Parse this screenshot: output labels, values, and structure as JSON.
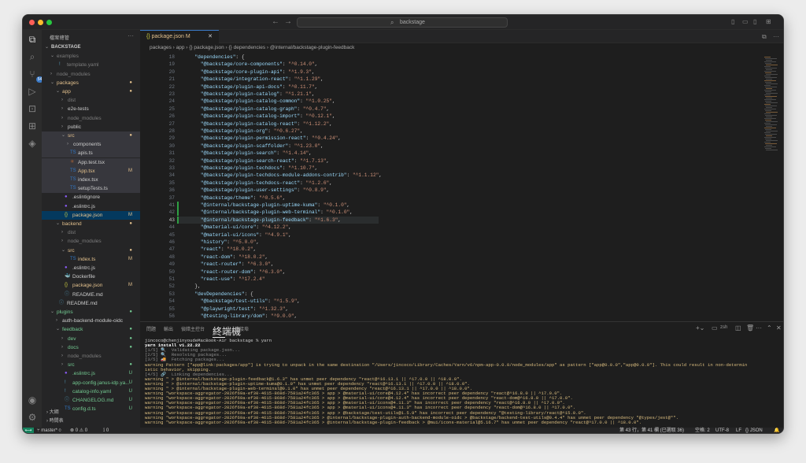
{
  "window": {
    "search_text": "backstage",
    "traffic": {
      "close": "#ff5f57",
      "min": "#febc2e",
      "max": "#28c840"
    }
  },
  "sidebar": {
    "header": "檔案總管",
    "more": "···",
    "tree": [
      {
        "label": "BACKSTAGE",
        "indent": 0,
        "arrow": "⌄",
        "style": "root"
      },
      {
        "label": "examples",
        "indent": 1,
        "arrow": "⌄",
        "style": "dim"
      },
      {
        "label": "template.yaml",
        "indent": 2,
        "arrow": "",
        "style": "dim",
        "icon": "!"
      },
      {
        "label": "node_modules",
        "indent": 1,
        "arrow": "›",
        "style": "dim"
      },
      {
        "label": "packages",
        "indent": 1,
        "arrow": "⌄",
        "style": "mod",
        "status": "●"
      },
      {
        "label": "app",
        "indent": 2,
        "arrow": "⌄",
        "style": "mod",
        "status": "●"
      },
      {
        "label": "dist",
        "indent": 3,
        "arrow": "›",
        "style": "dim"
      },
      {
        "label": "e2e-tests",
        "indent": 3,
        "arrow": "›",
        "style": ""
      },
      {
        "label": "node_modules",
        "indent": 3,
        "arrow": "›",
        "style": "dim"
      },
      {
        "label": "public",
        "indent": 3,
        "arrow": "›",
        "style": ""
      },
      {
        "label": "src",
        "indent": 3,
        "arrow": "⌄",
        "style": "mod",
        "status": "●",
        "sel": true
      },
      {
        "label": "components",
        "indent": 4,
        "arrow": "›",
        "style": "",
        "sel": true
      },
      {
        "label": "apis.ts",
        "indent": 4,
        "arrow": "",
        "style": "",
        "icon": "TS",
        "sel": true
      },
      {
        "label": "App.test.tsx",
        "indent": 4,
        "arrow": "",
        "style": "",
        "icon": "⚛",
        "sel": true
      },
      {
        "label": "App.tsx",
        "indent": 4,
        "arrow": "",
        "style": "mod",
        "icon": "TS",
        "status": "M",
        "sel": true
      },
      {
        "label": "index.tsx",
        "indent": 4,
        "arrow": "",
        "style": "",
        "icon": "TS",
        "sel": true
      },
      {
        "label": "setupTests.ts",
        "indent": 4,
        "arrow": "",
        "style": "",
        "icon": "TS",
        "sel": true
      },
      {
        "label": ".eslintignore",
        "indent": 3,
        "arrow": "",
        "style": "",
        "icon": "●"
      },
      {
        "label": ".eslintrc.js",
        "indent": 3,
        "arrow": "",
        "style": "",
        "icon": "●"
      },
      {
        "label": "package.json",
        "indent": 3,
        "arrow": "",
        "style": "mod",
        "icon": "{}",
        "status": "M",
        "cur": true
      },
      {
        "label": "backend",
        "indent": 2,
        "arrow": "⌄",
        "style": "mod",
        "status": "●"
      },
      {
        "label": "dist",
        "indent": 3,
        "arrow": "›",
        "style": "dim"
      },
      {
        "label": "node_modules",
        "indent": 3,
        "arrow": "›",
        "style": "dim"
      },
      {
        "label": "src",
        "indent": 3,
        "arrow": "⌄",
        "style": "mod",
        "status": "●"
      },
      {
        "label": "index.ts",
        "indent": 4,
        "arrow": "",
        "style": "mod",
        "icon": "TS",
        "status": "M"
      },
      {
        "label": ".eslintrc.js",
        "indent": 3,
        "arrow": "",
        "style": "",
        "icon": "●"
      },
      {
        "label": "Dockerfile",
        "indent": 3,
        "arrow": "",
        "style": "",
        "icon": "🐳"
      },
      {
        "label": "package.json",
        "indent": 3,
        "arrow": "",
        "style": "mod",
        "icon": "{}",
        "status": "M"
      },
      {
        "label": "README.md",
        "indent": 3,
        "arrow": "",
        "style": "",
        "icon": "ⓘ"
      },
      {
        "label": "README.md",
        "indent": 2,
        "arrow": "",
        "style": "",
        "icon": "ⓘ"
      },
      {
        "label": "plugins",
        "indent": 1,
        "arrow": "⌄",
        "style": "unt",
        "status": "●"
      },
      {
        "label": "auth-backend-module-oidc",
        "indent": 2,
        "arrow": "›",
        "style": ""
      },
      {
        "label": "feedback",
        "indent": 2,
        "arrow": "⌄",
        "style": "unt",
        "status": "●"
      },
      {
        "label": "dev",
        "indent": 3,
        "arrow": "›",
        "style": "unt",
        "status": "●"
      },
      {
        "label": "docs",
        "indent": 3,
        "arrow": "›",
        "style": "unt",
        "status": "●"
      },
      {
        "label": "node_modules",
        "indent": 3,
        "arrow": "›",
        "style": "dim"
      },
      {
        "label": "src",
        "indent": 3,
        "arrow": "›",
        "style": "unt",
        "status": "●"
      },
      {
        "label": ".eslintrc.js",
        "indent": 3,
        "arrow": "",
        "style": "unt",
        "icon": "●",
        "status": "U"
      },
      {
        "label": "app-config.janus-idp.ya...",
        "indent": 3,
        "arrow": "",
        "style": "unt",
        "icon": "!",
        "status": "U"
      },
      {
        "label": "catalog-info.yaml",
        "indent": 3,
        "arrow": "",
        "style": "unt",
        "icon": "!",
        "status": "U"
      },
      {
        "label": "CHANGELOG.md",
        "indent": 3,
        "arrow": "",
        "style": "unt",
        "icon": "ⓘ",
        "status": "U"
      },
      {
        "label": "config.d.ts",
        "indent": 3,
        "arrow": "",
        "style": "unt",
        "icon": "TS",
        "status": "U"
      }
    ],
    "outline": "大綱",
    "timeline": "時間表"
  },
  "editor": {
    "tab_label": "package.json",
    "tab_status": "M",
    "breadcrumb": [
      "packages",
      "app",
      "{} package.json",
      "{} dependencies",
      "@internal/backstage-plugin-feedback"
    ],
    "current_line": 43,
    "lines": [
      {
        "n": 18,
        "t": "  \"dependencies\": {"
      },
      {
        "n": 19,
        "t": "    \"@backstage/core-components\": \"^0.14.0\","
      },
      {
        "n": 20,
        "t": "    \"@backstage/core-plugin-api\": \"^1.9.3\","
      },
      {
        "n": 21,
        "t": "    \"@backstage/integration-react\": \"^1.1.29\","
      },
      {
        "n": 22,
        "t": "    \"@backstage/plugin-api-docs\": \"^0.11.7\","
      },
      {
        "n": 23,
        "t": "    \"@backstage/plugin-catalog\": \"^1.21.1\","
      },
      {
        "n": 24,
        "t": "    \"@backstage/plugin-catalog-common\": \"^1.0.25\","
      },
      {
        "n": 25,
        "t": "    \"@backstage/plugin-catalog-graph\": \"^0.4.7\","
      },
      {
        "n": 26,
        "t": "    \"@backstage/plugin-catalog-import\": \"^0.12.1\","
      },
      {
        "n": 27,
        "t": "    \"@backstage/plugin-catalog-react\": \"^1.12.2\","
      },
      {
        "n": 28,
        "t": "    \"@backstage/plugin-org\": \"^0.6.27\","
      },
      {
        "n": 29,
        "t": "    \"@backstage/plugin-permission-react\": \"^0.4.24\","
      },
      {
        "n": 30,
        "t": "    \"@backstage/plugin-scaffolder\": \"^1.23.0\","
      },
      {
        "n": 31,
        "t": "    \"@backstage/plugin-search\": \"^1.4.14\","
      },
      {
        "n": 32,
        "t": "    \"@backstage/plugin-search-react\": \"^1.7.13\","
      },
      {
        "n": 33,
        "t": "    \"@backstage/plugin-techdocs\": \"^1.10.7\","
      },
      {
        "n": 34,
        "t": "    \"@backstage/plugin-techdocs-module-addons-contrib\": \"^1.1.12\","
      },
      {
        "n": 35,
        "t": "    \"@backstage/plugin-techdocs-react\": \"^1.2.6\","
      },
      {
        "n": 36,
        "t": "    \"@backstage/plugin-user-settings\": \"^0.8.9\","
      },
      {
        "n": 37,
        "t": "    \"@backstage/theme\": \"^0.5.6\","
      },
      {
        "n": 41,
        "t": "    \"@internal/backstage-plugin-uptime-kuma\": \"^0.1.0\","
      },
      {
        "n": 42,
        "t": "    \"@internal/backstage-plugin-web-terminal\": \"^0.1.0\","
      },
      {
        "n": 43,
        "t": "    \"@internal/backstage-plugin-feedback\": \"^1.6.3\","
      },
      {
        "n": 44,
        "t": "    \"@material-ui/core\": \"^4.12.2\","
      },
      {
        "n": 45,
        "t": "    \"@material-ui/icons\": \"^4.9.1\","
      },
      {
        "n": 46,
        "t": "    \"history\": \"^5.0.0\","
      },
      {
        "n": 47,
        "t": "    \"react\": \"^18.0.2\","
      },
      {
        "n": 48,
        "t": "    \"react-dom\": \"^18.0.2\","
      },
      {
        "n": 49,
        "t": "    \"react-router\": \"^6.3.0\","
      },
      {
        "n": 50,
        "t": "    \"react-router-dom\": \"^6.3.0\","
      },
      {
        "n": 51,
        "t": "    \"react-use\": \"^17.2.4\""
      },
      {
        "n": 52,
        "t": "  },"
      },
      {
        "n": 53,
        "t": "  \"devDependencies\": {"
      },
      {
        "n": 54,
        "t": "    \"@backstage/test-utils\": \"^1.5.9\","
      },
      {
        "n": 55,
        "t": "    \"@playwright/test\": \"^1.32.3\","
      },
      {
        "n": 56,
        "t": "    \"@testing-library/dom\": \"^9.0.0\","
      }
    ]
  },
  "panel": {
    "tabs": [
      "問題",
      "輸出",
      "偵錯主控台",
      "終端機",
      "連接埠"
    ],
    "active_tab": "終端機",
    "shell": "zsh",
    "terminal": [
      {
        "c": "",
        "t": "jincoco@chenjinyoudeMacBook-Air backstage % yarn"
      },
      {
        "c": "bold",
        "t": "yarn install v1.22.22"
      },
      {
        "c": "gray",
        "t": "[1/5] 🔍  Validating package.json..."
      },
      {
        "c": "gray",
        "t": "[2/5] 🔍  Resolving packages..."
      },
      {
        "c": "gray",
        "t": "[3/5] 🚚  Fetching packages..."
      },
      {
        "c": "warn",
        "t": "warning Pattern [\"app@link:packages/app\"] is trying to unpack in the same destination \"/Users/jincoco/Library/Caches/Yarn/v6/npm-app-0.0.0/node_modules/app\" as pattern [\"app@0.0.0\",\"app@0.0.0\"]. This could result in non-determin"
      },
      {
        "c": "warn",
        "t": "istic behavior, skipping."
      },
      {
        "c": "gray",
        "t": "[4/5] 🔗  Linking dependencies..."
      },
      {
        "c": "warn",
        "t": "warning \" > @internal/backstage-plugin-feedback@1.6.3\" has unmet peer dependency \"react@^16.13.1 || ^17.0.0 || ^18.0.0\"."
      },
      {
        "c": "warn",
        "t": "warning \" > @internal/backstage-plugin-uptime-kuma@0.1.0\" has unmet peer dependency \"react@^16.13.1 || ^17.0.0 || ^18.0.0\"."
      },
      {
        "c": "warn",
        "t": "warning \" > @internal/backstage-plugin-web-terminal@0.1.0\" has unmet peer dependency \"react@^16.13.1 || ^17.0.0 || ^18.0.0\"."
      },
      {
        "c": "warn",
        "t": "warning \"workspace-aggregator-2026f69a-ef30-4615-868d-7581a24fc365 > app > @material-ui/core@4.12.4\" has incorrect peer dependency \"react@^16.8.0 || ^17.0.0\"."
      },
      {
        "c": "warn",
        "t": "warning \"workspace-aggregator-2026f69a-ef30-4615-868d-7581a24fc365 > app > @material-ui/core@4.12.4\" has incorrect peer dependency \"react-dom@^16.8.0 || ^17.0.0\"."
      },
      {
        "c": "warn",
        "t": "warning \"workspace-aggregator-2026f69a-ef30-4615-868d-7581a24fc365 > app > @material-ui/icons@4.11.3\" has incorrect peer dependency \"react@^16.8.0 || ^17.0.0\"."
      },
      {
        "c": "warn",
        "t": "warning \"workspace-aggregator-2026f69a-ef30-4615-868d-7581a24fc365 > app > @material-ui/icons@4.11.3\" has incorrect peer dependency \"react-dom@^16.8.0 || ^17.0.0\"."
      },
      {
        "c": "warn",
        "t": "warning \"workspace-aggregator-2026f69a-ef30-4615-868d-7581a24fc365 > app > @backstage/test-utils@1.5.9\" has incorrect peer dependency \"@testing-library/react@^15.0.0\"."
      },
      {
        "c": "warn",
        "t": "warning \"workspace-aggregator-2026f69a-ef30-4615-868d-7581a24fc365 > @internal/backstage-plugin-auth-backend-module-oidc > @backstage/backend-test-utils@0.4.4\" has unmet peer dependency \"@types/jest@*\"."
      },
      {
        "c": "warn",
        "t": "warning \"workspace-aggregator-2026f69a-ef30-4615-868d-7581a24fc365 > @internal/backstage-plugin-feedback > @mui/icons-material@5.16.7\" has unmet peer dependency \"react@^17.0.0 || ^18.0.0\"."
      }
    ]
  },
  "status": {
    "branch": "master*",
    "errors": "0",
    "warnings": "0",
    "ports": "0",
    "position": "第 43 行，第 41 欄 (已選取 36)",
    "spaces": "空格: 2",
    "encoding": "UTF-8",
    "eol": "LF",
    "language": "JSON"
  }
}
